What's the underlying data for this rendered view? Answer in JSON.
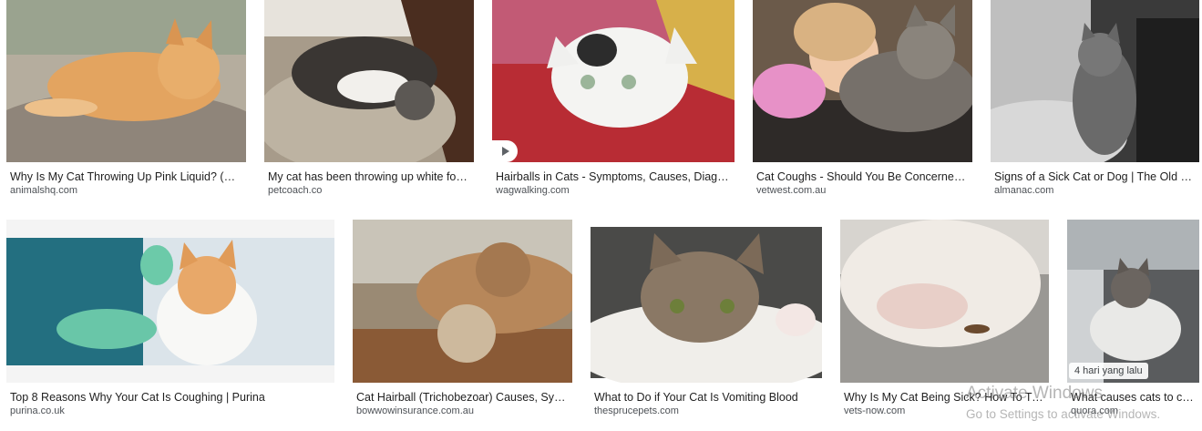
{
  "results": [
    {
      "title": "Why Is My Cat Throwing Up Pink Liquid? (Ex…",
      "source": "animalshq.com"
    },
    {
      "title": "My cat has been throwing up white foa…",
      "source": "petcoach.co"
    },
    {
      "title": "Hairballs in Cats - Symptoms, Causes, Diagn…",
      "source": "wagwalking.com"
    },
    {
      "title": "Cat Coughs - Should You Be Concerned?…",
      "source": "vetwest.com.au"
    },
    {
      "title": "Signs of a Sick Cat or Dog | The Old Fa…",
      "source": "almanac.com"
    },
    {
      "title": "Top 8 Reasons Why Your Cat Is Coughing | Purina",
      "source": "purina.co.uk"
    },
    {
      "title": "Cat Hairball (Trichobezoar) Causes, Sym…",
      "source": "bowwowinsurance.com.au"
    },
    {
      "title": "What to Do if Your Cat Is Vomiting Blood",
      "source": "thesprucepets.com"
    },
    {
      "title": "Why Is My Cat Being Sick? How To Tre…",
      "source": "vets-now.com"
    },
    {
      "title": "What causes cats to co…",
      "source": "quora.com",
      "badge": "4 hari yang lalu"
    }
  ],
  "watermark": {
    "line1": "Activate Windows",
    "line2": "Go to Settings to activate Windows."
  },
  "colors": {
    "title": "#1f1f1f",
    "source": "#4d5156",
    "background": "#ffffff"
  }
}
